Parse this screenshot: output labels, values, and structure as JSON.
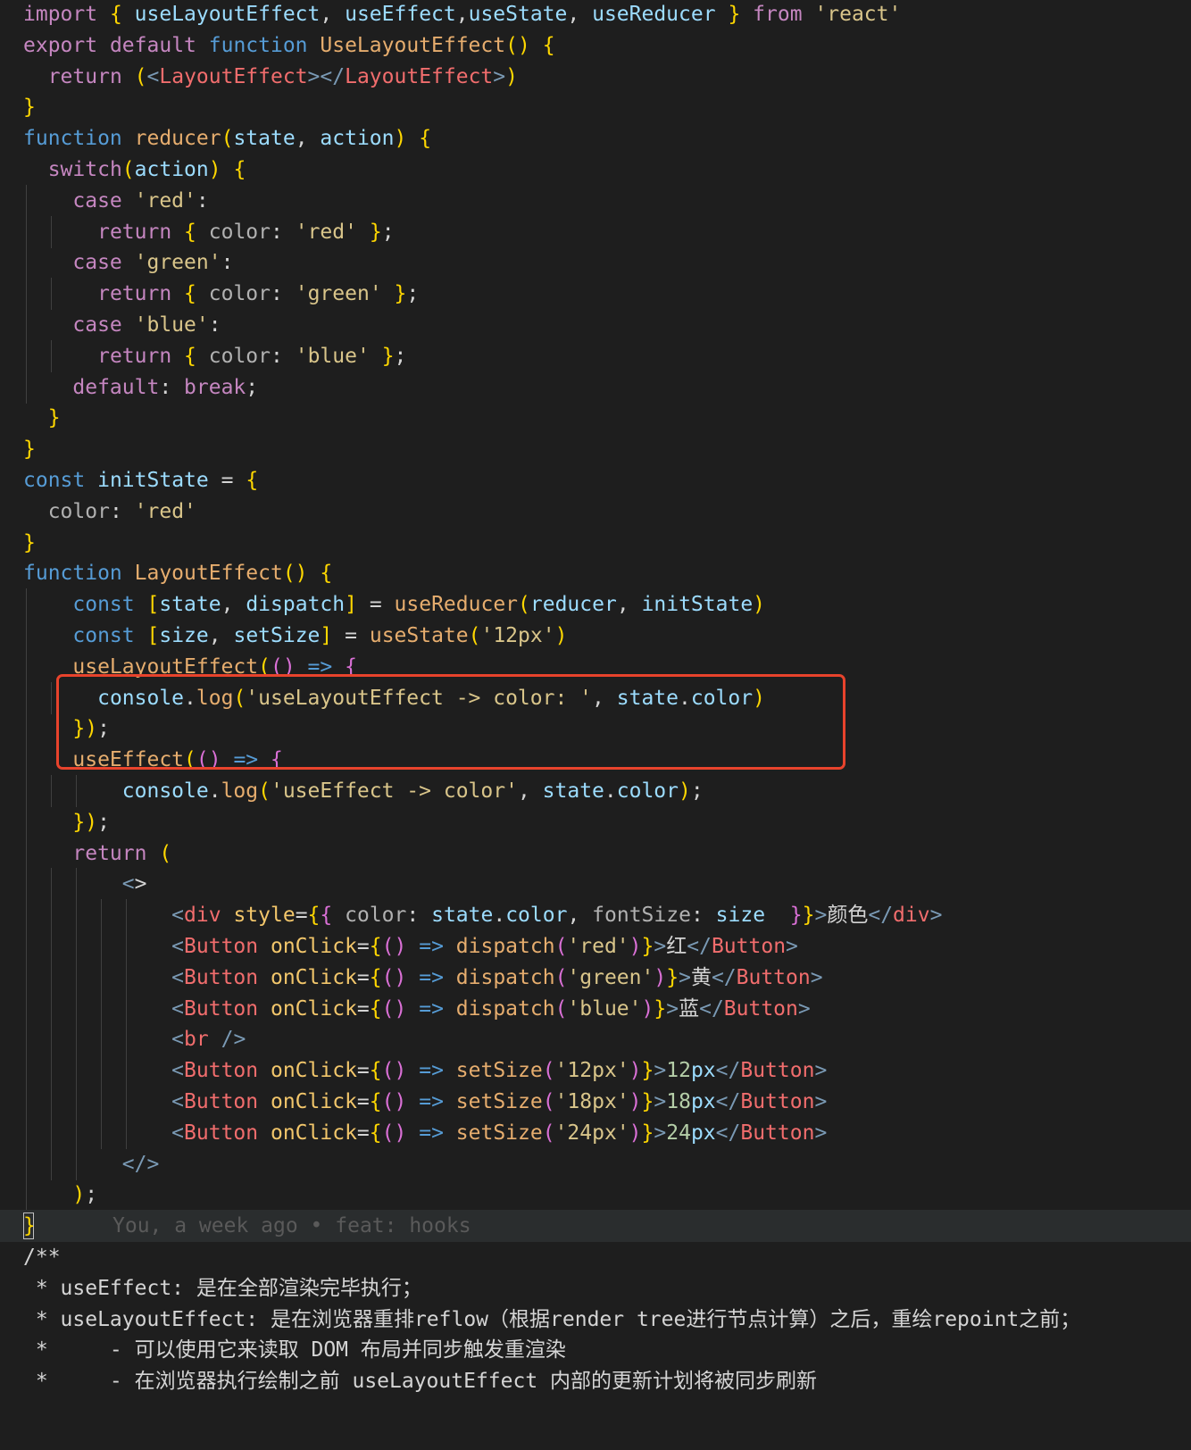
{
  "palette": {
    "keyword": "#c586c0",
    "control": "#c586c0",
    "function": "#e6ad6e",
    "string": "#d9c58a",
    "variable": "#9cdcfe",
    "property": "#b1b1b1",
    "tag": "#f16d6d",
    "attribute": "#f2c66b",
    "punct": "#d4d4d4",
    "bracket1": "#ffd700",
    "bracket2": "#da70d6",
    "bracket3": "#179fff",
    "comment": "#d4d4d4",
    "blame": "#5a5a5a",
    "highlight_box": "#e8432c"
  },
  "editor": {
    "blame_annotation": "You, a week ago • feat: hooks",
    "lines": [
      "import { useLayoutEffect, useEffect,useState, useReducer } from 'react'",
      "export default function UseLayoutEffect() {",
      "  return (<LayoutEffect></LayoutEffect>)",
      "}",
      "function reducer(state, action) {",
      "  switch(action) {",
      "    case 'red':",
      "      return { color: 'red' };",
      "    case 'green':",
      "      return { color: 'green' };",
      "    case 'blue':",
      "      return { color: 'blue' };",
      "    default: break;",
      "  }",
      "}",
      "const initState = {",
      "  color: 'red'",
      "}",
      "function LayoutEffect() {",
      "    const [state, dispatch] = useReducer(reducer, initState)",
      "    const [size, setSize] = useState('12px')",
      "    useLayoutEffect(() => {",
      "      console.log('useLayoutEffect -> color: ', state.color)",
      "    });",
      "    useEffect(() => {",
      "        console.log('useEffect -> color', state.color);",
      "    });",
      "    return (",
      "        <>",
      "            <div style={{ color: state.color, fontSize: size  }}>颜色</div>",
      "            <Button onClick={() => dispatch('red')}>红</Button>",
      "            <Button onClick={() => dispatch('green')}>黄</Button>",
      "            <Button onClick={() => dispatch('blue')}>蓝</Button>",
      "            <br />",
      "            <Button onClick={() => setSize('12px')}>12px</Button>",
      "            <Button onClick={() => setSize('18px')}>18px</Button>",
      "            <Button onClick={() => setSize('24px')}>24px</Button>",
      "        </>",
      "    );",
      "}",
      "/**",
      " * useEffect: 是在全部渲染完毕执行；",
      " * useLayoutEffect: 是在浏览器重排reflow（根据render tree进行节点计算）之后，重绘repoint之前；",
      " *     - 可以使用它来读取 DOM 布局并同步触发重渲染",
      " *     - 在浏览器执行绘制之前 useLayoutEffect 内部的更新计划将被同步刷新"
    ]
  }
}
